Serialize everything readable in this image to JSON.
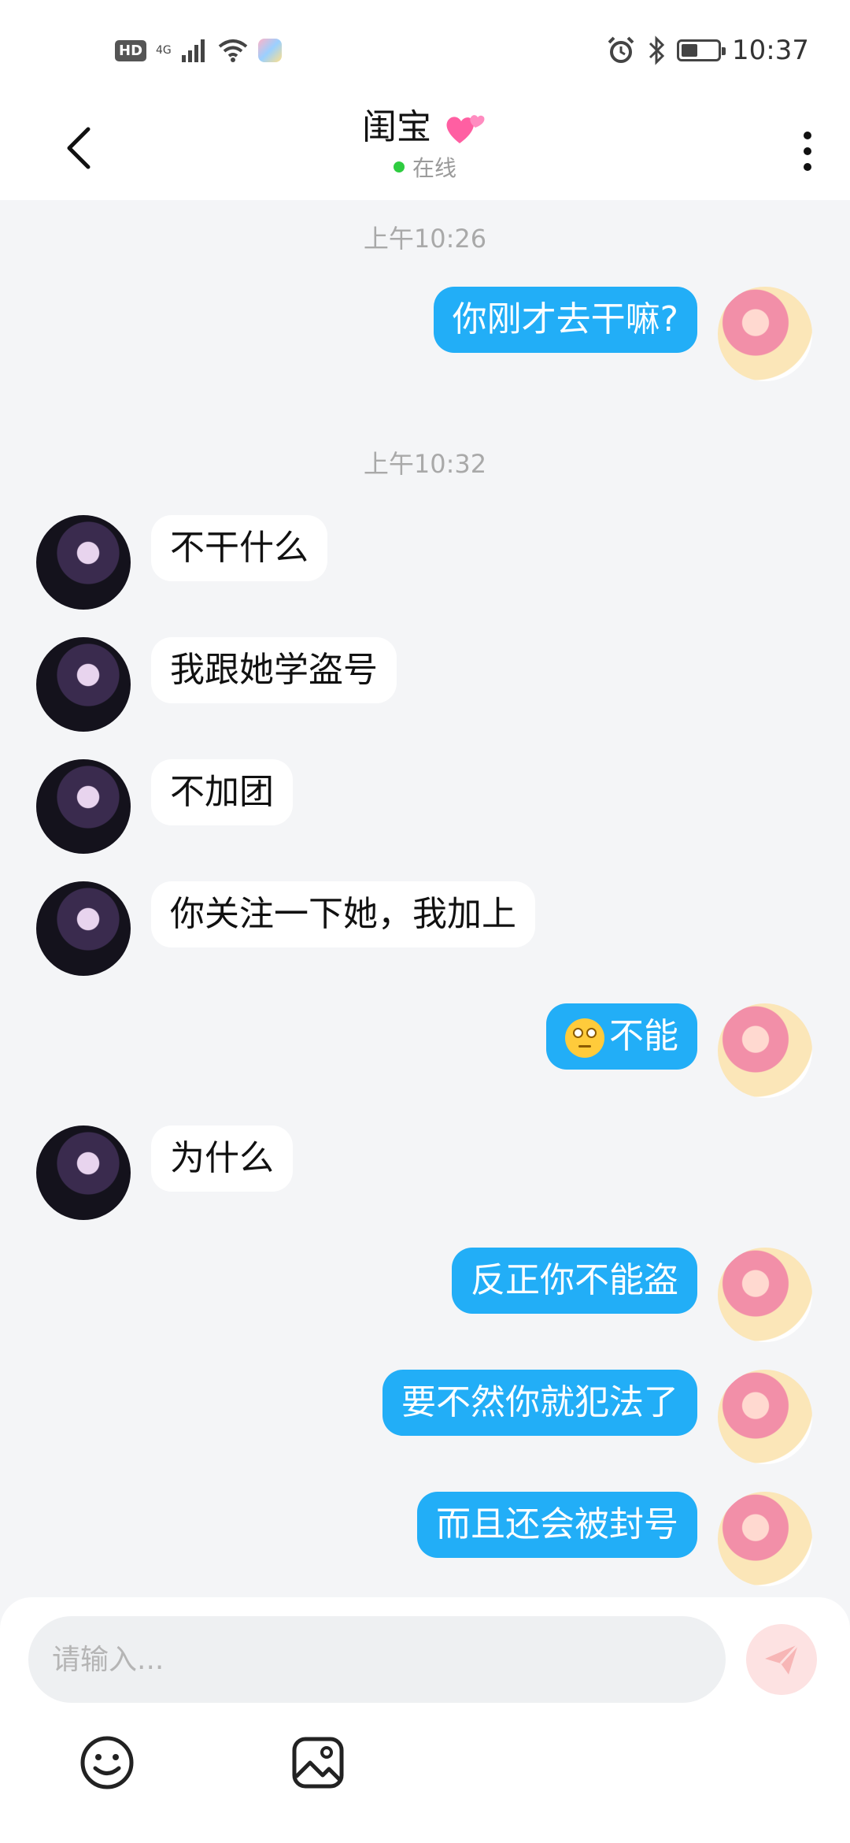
{
  "status_bar": {
    "hd": "HD",
    "network": "4G",
    "time": "10:37",
    "battery_level": 0.45
  },
  "header": {
    "title": "闺宝",
    "status": "在线"
  },
  "chat": {
    "timestamps": [
      "上午10:26",
      "上午10:32"
    ],
    "messages": [
      {
        "side": "out",
        "text": "你刚才去干嘛?"
      },
      {
        "side": "in",
        "text": "不干什么"
      },
      {
        "side": "in",
        "text": "我跟她学盗号"
      },
      {
        "side": "in",
        "text": "不加团"
      },
      {
        "side": "in",
        "text": "你关注一下她，我加上"
      },
      {
        "side": "out",
        "text": "不能",
        "emoji": "face-with-rolling-eyes"
      },
      {
        "side": "in",
        "text": "为什么"
      },
      {
        "side": "out",
        "text": "反正你不能盗"
      },
      {
        "side": "out",
        "text": "要不然你就犯法了"
      },
      {
        "side": "out",
        "text": "而且还会被封号"
      }
    ]
  },
  "composer": {
    "placeholder": "请输入..."
  },
  "colors": {
    "outgoing_bubble": "#22aef7",
    "incoming_bubble": "#ffffff",
    "online_dot": "#2ecc40",
    "send_button_disabled": "#fde2e2"
  },
  "icons": [
    "back-arrow-icon",
    "more-vertical-icon",
    "send-icon",
    "smiley-icon",
    "image-icon",
    "alarm-icon",
    "bluetooth-icon",
    "wifi-icon",
    "signal-icon"
  ]
}
